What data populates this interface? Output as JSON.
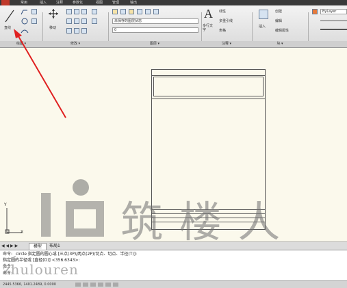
{
  "appbar": {
    "tabs": [
      "常用",
      "插入",
      "注释",
      "参数化",
      "视图",
      "管理",
      "输出"
    ]
  },
  "ribbon": {
    "draw": {
      "line_label": "直线"
    },
    "modify": {
      "move_label": "移动"
    },
    "layers": {
      "layer_state": "未保存的图层状态",
      "layer_current": "0"
    },
    "annotation": {
      "text_label": "多行文字",
      "linear": "线性",
      "multileader": "多重引线",
      "table": "表格"
    },
    "block": {
      "insert_label": "插入",
      "create": "创建",
      "edit": "编辑",
      "edit_attr": "编辑属性"
    },
    "properties": {
      "bylayer": "ByLayer"
    },
    "groups": [
      "绘图 ▾",
      "修改 ▾",
      "图层 ▾",
      "注释 ▾",
      "块 ▾"
    ]
  },
  "tabs": {
    "model": "模型",
    "layout": "布局1"
  },
  "command": {
    "line1": "命令: _circle 指定圆的圆心或 [三点(3P)/两点(2P)/切点、切点、半径(T)]:",
    "line2": "指定圆的半径或 [直径(D)] <356.6343>:",
    "line3": "命令:",
    "line4": "命令:"
  },
  "status": {
    "coords": "2445.5366, 1401.2489, 0.0000"
  },
  "watermark": {
    "brand": "筑 楼 人",
    "url": "zhulouren"
  },
  "colors": {
    "arrow": "#e02020",
    "accent": "#3b6ea5"
  },
  "ucs": {
    "y": "Y",
    "x": "X"
  }
}
